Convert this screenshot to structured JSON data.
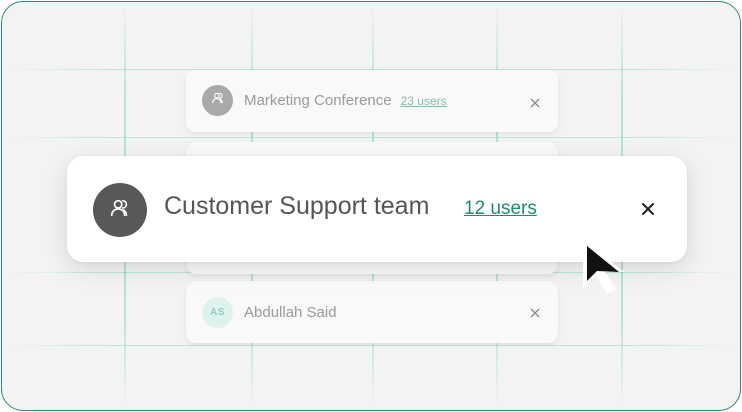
{
  "list": {
    "items": [
      {
        "label": "Marketing Conference",
        "link": "23 users",
        "avatar_icon": "group-icon"
      },
      {
        "label": "Customer Support team",
        "link": "12 users",
        "avatar_icon": "group-icon",
        "highlighted": true
      },
      {
        "label": "Abdullah Said",
        "avatar_initials": "AS"
      }
    ]
  },
  "colors": {
    "accent": "#1f8a6e",
    "accent_light": "#7cbfae",
    "frame_border": "#2e8a70",
    "grid_line": "#8cdcc8"
  },
  "icons": {
    "close": "close-icon",
    "pointer": "cursor-arrow-icon"
  }
}
